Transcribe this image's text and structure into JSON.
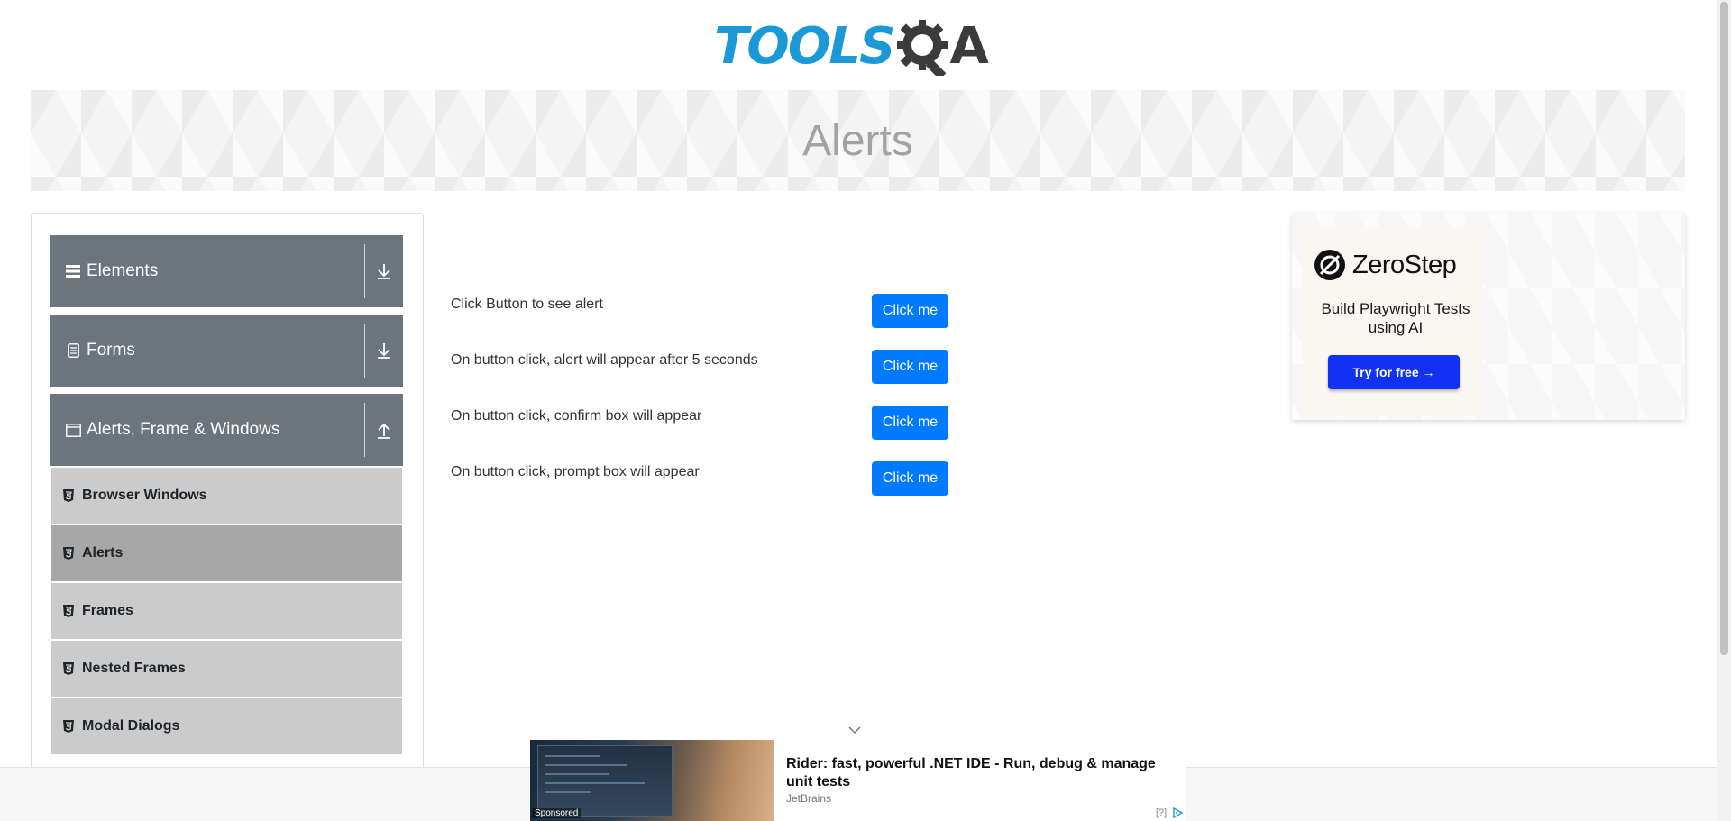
{
  "header": {
    "logo_text_tools": "TOOLS",
    "logo_text_a": "A"
  },
  "banner": {
    "title": "Alerts"
  },
  "sidebar": {
    "groups": [
      {
        "label": "Elements",
        "expanded": false
      },
      {
        "label": "Forms",
        "expanded": false
      },
      {
        "label": "Alerts, Frame & Windows",
        "expanded": true
      }
    ],
    "items": [
      {
        "label": "Browser Windows",
        "active": false
      },
      {
        "label": "Alerts",
        "active": true
      },
      {
        "label": "Frames",
        "active": false
      },
      {
        "label": "Nested Frames",
        "active": false
      },
      {
        "label": "Modal Dialogs",
        "active": false
      }
    ]
  },
  "main": {
    "rows": [
      {
        "text": "Click Button to see alert",
        "button": "Click me"
      },
      {
        "text": "On button click, alert will appear after 5 seconds",
        "button": "Click me"
      },
      {
        "text": "On button click, confirm box will appear",
        "button": "Click me"
      },
      {
        "text": "On button click, prompt box will appear",
        "button": "Click me"
      }
    ]
  },
  "ad": {
    "brand": "ZeroStep",
    "tagline": "Build Playwright Tests using AI",
    "cta": "Try for free →"
  },
  "sponsored": {
    "label": "Sponsored",
    "title": "Rider: fast, powerful .NET IDE - Run, debug & manage unit tests",
    "source": "JetBrains",
    "help": "[?]"
  },
  "colors": {
    "primary_button": "#007bff",
    "sidebar_group": "#6c757d",
    "sidebar_item": "#cbcbcb",
    "sidebar_item_active": "#a7a7a7",
    "logo_blue": "#1a99d6",
    "cta_blue": "#1132f5"
  }
}
